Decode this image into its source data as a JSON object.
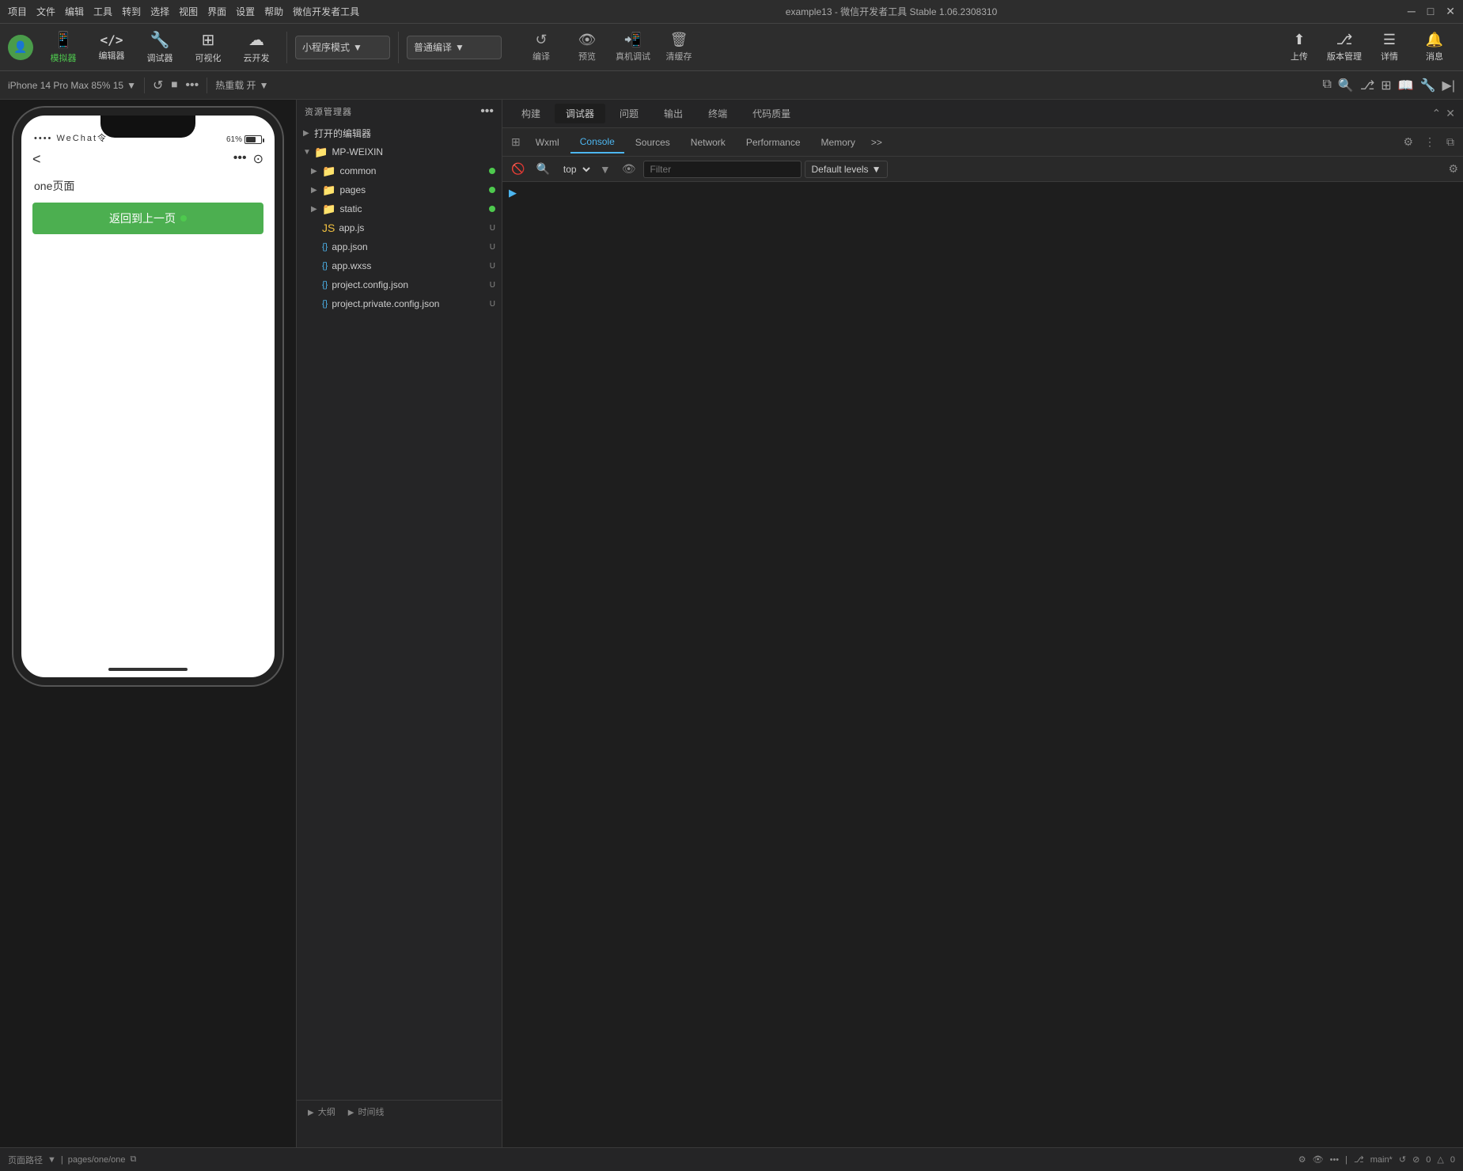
{
  "titlebar": {
    "menus": [
      "项目",
      "文件",
      "编辑",
      "工具",
      "转到",
      "选择",
      "视图",
      "界面",
      "设置",
      "帮助",
      "微信开发者工具"
    ],
    "title": "example13 - 微信开发者工具 Stable 1.06.2308310",
    "controls": [
      "─",
      "□",
      "✕"
    ]
  },
  "toolbar": {
    "buttons": [
      {
        "icon": "📱",
        "label": "模拟器",
        "active": true
      },
      {
        "icon": "</>",
        "label": "编辑器",
        "active": false
      },
      {
        "icon": "🔧",
        "label": "调试器",
        "active": false
      },
      {
        "icon": "⊞",
        "label": "可视化",
        "active": false
      },
      {
        "icon": "☁",
        "label": "云开发",
        "active": false
      }
    ],
    "mode_select": "小程序模式",
    "compile_select": "普通编译",
    "actions": [
      {
        "icon": "↺",
        "label": "编译"
      },
      {
        "icon": "👁",
        "label": "预览"
      },
      {
        "icon": "📱",
        "label": "真机调试"
      },
      {
        "icon": "🗑",
        "label": "清缓存"
      }
    ],
    "right_buttons": [
      {
        "icon": "⬆",
        "label": "上传"
      },
      {
        "icon": "⎇",
        "label": "版本管理"
      },
      {
        "icon": "☰",
        "label": "详情"
      },
      {
        "icon": "🔔",
        "label": "消息"
      }
    ]
  },
  "subtitle": {
    "device": "iPhone 14 Pro Max 85% 15",
    "device_arrow": "▼",
    "hotreload": "热重载 开",
    "hotreload_arrow": "▼"
  },
  "simulator": {
    "status_left": "•••• WeChat令",
    "battery_pct": "61%",
    "page_title": "one页面",
    "back_btn": "返回到上一页",
    "dot_color": "#4ec94e"
  },
  "explorer": {
    "title": "资源管理器",
    "section_open": "打开的编辑器",
    "root": "MP-WEIXIN",
    "files": [
      {
        "name": "common",
        "type": "folder",
        "color": "#4caf50",
        "status": ""
      },
      {
        "name": "pages",
        "type": "folder",
        "color": "#f44336",
        "status": ""
      },
      {
        "name": "static",
        "type": "folder",
        "color": "#4caf50",
        "status": ""
      },
      {
        "name": "app.js",
        "type": "js",
        "color": "#f0c040",
        "status": "U"
      },
      {
        "name": "app.json",
        "type": "json",
        "color": "#4db6f0",
        "status": "U"
      },
      {
        "name": "app.wxss",
        "type": "wxss",
        "color": "#4db6f0",
        "status": "U"
      },
      {
        "name": "project.config.json",
        "type": "json",
        "color": "#4db6f0",
        "status": "U"
      },
      {
        "name": "project.private.config.json",
        "type": "json",
        "color": "#4db6f0",
        "status": "U"
      }
    ]
  },
  "debug_tabs_top": {
    "tabs": [
      "构建",
      "调试器",
      "问题",
      "输出",
      "终端",
      "代码质量"
    ]
  },
  "devtools": {
    "tabs": [
      "Wxml",
      "Console",
      "Sources",
      "Network",
      "Performance",
      "Memory"
    ],
    "active_tab": "Console",
    "toolbar": {
      "context": "top",
      "filter_placeholder": "Filter",
      "levels": "Default levels"
    }
  },
  "bottom_bar": {
    "path_label": "页面路径",
    "path_value": "pages/one/one",
    "branch": "main*",
    "errors": "0",
    "warnings": "0"
  },
  "outline": {
    "tabs": [
      "大纲",
      "时间线"
    ]
  },
  "colors": {
    "active_green": "#4ec94e",
    "active_blue": "#4db6f0",
    "bg_dark": "#1e1e1e",
    "bg_mid": "#252526",
    "bg_light": "#2d2d2d"
  }
}
